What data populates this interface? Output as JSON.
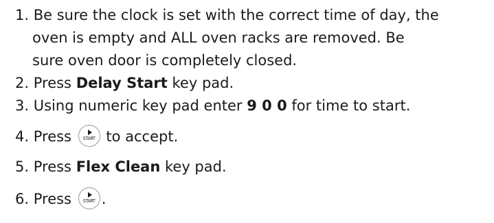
{
  "steps": [
    {
      "number": "1.",
      "lines": [
        "Be sure the clock is set with the correct time of day, the",
        "oven is empty and ALL oven racks are removed. Be",
        "sure oven door is completely closed."
      ]
    },
    {
      "number": "2.",
      "pre": "Press ",
      "bold": "Delay Start",
      "post": " key pad."
    },
    {
      "number": "3.",
      "pre": "Using numeric key pad enter ",
      "bold": "9 0 0",
      "post": " for time to start."
    },
    {
      "number": "4.",
      "pre": "Press ",
      "icon_label": "START",
      "icon": "start-key-icon",
      "post": " to accept."
    },
    {
      "number": "5.",
      "pre": "Press ",
      "bold": "Flex Clean",
      "post": " key pad."
    },
    {
      "number": "6.",
      "pre": "Press ",
      "icon_label": "START",
      "icon": "start-key-icon",
      "post": "."
    }
  ]
}
